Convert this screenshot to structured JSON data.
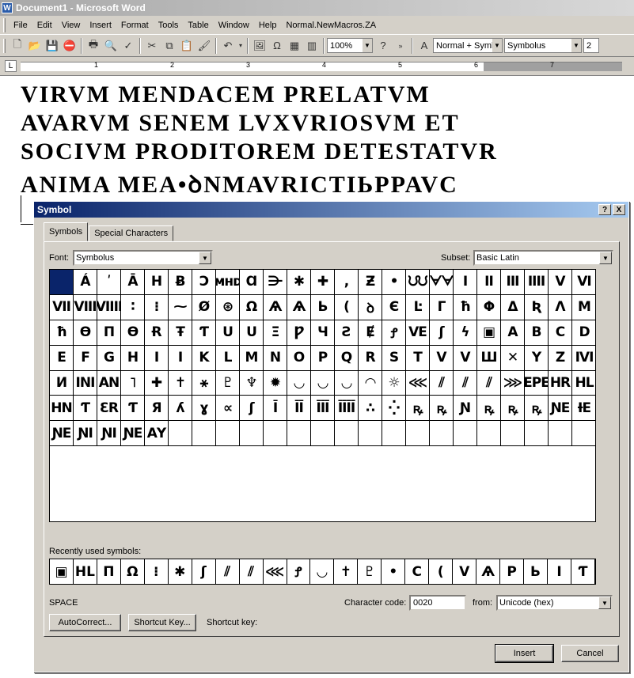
{
  "window": {
    "title": "Document1 - Microsoft Word",
    "icon": "W"
  },
  "menu": [
    "File",
    "Edit",
    "View",
    "Insert",
    "Format",
    "Tools",
    "Table",
    "Window",
    "Help",
    "Normal.NewMacros.ZA"
  ],
  "toolbar": {
    "zoom": "100%",
    "style": "Normal + Symb",
    "font": "Symbolus",
    "size": "2"
  },
  "ruler": {
    "tab_selector": "L",
    "numbers": [
      "1",
      "2",
      "3",
      "4",
      "5",
      "6",
      "7"
    ]
  },
  "document": {
    "lines": [
      "VIRVM  MENDACEM  PRELATVM",
      "AVARVM  SENEM  LVXVRIOSVM  ET",
      "SOCIVM  PRODITOREM  DETESTATVR",
      "ANIMA  MEA•ꝺNMAVRICTIЬPPAVC"
    ]
  },
  "dialog": {
    "title": "Symbol",
    "help_btn": "?",
    "close_btn": "X",
    "tabs": [
      "Symbols",
      "Special Characters"
    ],
    "font_label": "Font:",
    "font_value": "Symbolus",
    "subset_label": "Subset:",
    "subset_value": "Basic Latin",
    "symbols": [
      "",
      "Á",
      "ʹ",
      "Ā",
      "H",
      "Ƀ",
      "Ͻ",
      "ᴍʜᴅ",
      "Ɑ",
      "⋺",
      "✱",
      "✚",
      ",",
      "Ƶ",
      "•",
      "ᙀᙀ",
      "ᗄᗄ",
      "I",
      "II",
      "III",
      "IIII",
      "V",
      "VI",
      "VII",
      "VIII",
      "VIIII",
      "∶",
      "⁝",
      "⁓",
      "Ø",
      "⊛",
      "Ω",
      "Ѧ",
      "Ѧ",
      "Ь",
      "(",
      "ꝺ",
      "Є",
      "Ŀ",
      "Γ",
      "ħ",
      "Φ",
      "Δ",
      "Ʀ",
      "Λ",
      "Ⅿ",
      "ħ",
      "Ɵ",
      "Π",
      "Ɵ",
      "Ɍ",
      "Ŧ",
      "Ƭ",
      "U",
      "U",
      "Ξ",
      "Ƿ",
      "Ч",
      "Ƨ",
      "Ɇ",
      "Ꝭ",
      "VE",
      "ʃ",
      "ϟ",
      "▣",
      "A",
      "B",
      "C",
      "D",
      "E",
      "F",
      "G",
      "H",
      "I",
      "I",
      "K",
      "L",
      "M",
      "N",
      "O",
      "P",
      "Q",
      "R",
      "S",
      "T",
      "V",
      "V",
      "Ш",
      "✕",
      "Y",
      "Z",
      "IVI",
      "И",
      "ΙΝΙ",
      "ΑΝ",
      "˥",
      "✚",
      "✝",
      "⚹",
      "♇",
      "♆",
      "✹",
      "◡",
      "◡",
      "◡",
      "◠",
      "☼",
      "⋘",
      "⫽",
      "⫽",
      "⫽",
      "⋙",
      "EPE",
      "HR",
      "HL",
      "HN",
      "Ƭ",
      "ƐR",
      "Ƭ",
      "Я",
      "ʎ",
      "ɣ",
      "∝",
      "ʃ",
      "Ī",
      "ĪĪ",
      "ĪĪĪ",
      "ĪĪĪĪ",
      "∴",
      "⁛",
      "ꝶ",
      "ꝶ",
      "Ɲ",
      "ꝶ",
      "ꝶ",
      "ꝶ",
      "ƝE",
      "ƗE",
      "ƝE",
      "ƝI",
      "ƝI",
      "ƝE",
      "ΑΥ",
      "",
      "",
      "",
      "",
      "",
      "",
      "",
      "",
      "",
      "",
      "",
      "",
      "",
      "",
      "",
      "",
      "",
      ""
    ],
    "recent_label": "Recently used symbols:",
    "recent": [
      "▣",
      "HL",
      "Π",
      "Ω",
      "⁝",
      "✱",
      "ʃ",
      "⫽",
      "⫽",
      "⋘",
      "Ꝭ",
      "◡",
      "✝",
      "♇",
      "•",
      "C",
      "(",
      "V",
      "Ѧ",
      "P",
      "Ь",
      "I",
      "Ƭ"
    ],
    "char_name": "SPACE",
    "char_code_label": "Character code:",
    "char_code": "0020",
    "from_label": "from:",
    "from_value": "Unicode (hex)",
    "autocorrect_btn": "AutoCorrect...",
    "shortcut_btn": "Shortcut Key...",
    "shortcut_label": "Shortcut key:",
    "insert_btn": "Insert",
    "cancel_btn": "Cancel"
  }
}
